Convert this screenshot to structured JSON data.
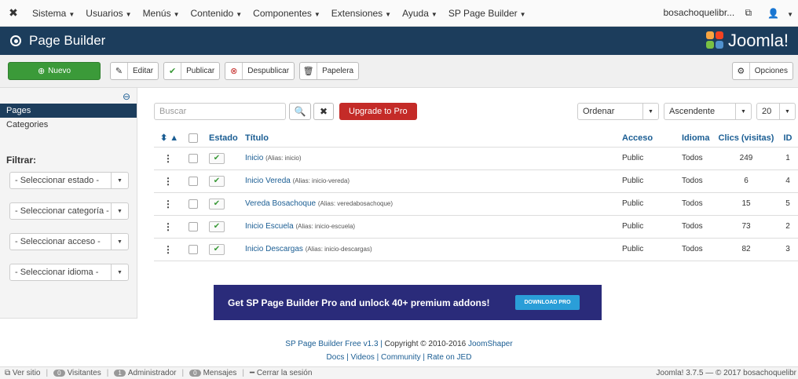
{
  "topbar": {
    "menu": [
      "Sistema",
      "Usuarios",
      "Menús",
      "Contenido",
      "Componentes",
      "Extensiones",
      "Ayuda",
      "SP Page Builder"
    ],
    "user": "bosachoquelibr...",
    "user_icon": "1"
  },
  "header": {
    "title": "Page Builder",
    "logo_text": "Joomla!"
  },
  "toolbar": {
    "new_label": "Nuevo",
    "edit_label": "Editar",
    "publish_label": "Publicar",
    "unpublish_label": "Despublicar",
    "trash_label": "Papelera",
    "options_label": "Opciones"
  },
  "sidebar": {
    "items": [
      "Pages",
      "Categories"
    ],
    "filter_title": "Filtrar:",
    "filters": [
      "- Seleccionar estado -",
      "- Seleccionar categoría -",
      "- Seleccionar acceso -",
      "- Seleccionar idioma -"
    ]
  },
  "list": {
    "search_placeholder": "Buscar",
    "upgrade_label": "Upgrade to Pro",
    "order_label": "Ordenar",
    "direction_label": "Ascendente",
    "limit_label": "20",
    "headers": {
      "estado": "Estado",
      "titulo": "Título",
      "acceso": "Acceso",
      "idioma": "Idioma",
      "clics": "Clics (visitas)",
      "id": "ID"
    },
    "rows": [
      {
        "title": "Inicio",
        "alias": "(Alias: inicio)",
        "access": "Public",
        "language": "Todos",
        "hits": "249",
        "id": "1"
      },
      {
        "title": "Inicio Vereda",
        "alias": "(Alias: inicio-vereda)",
        "access": "Public",
        "language": "Todos",
        "hits": "6",
        "id": "4"
      },
      {
        "title": "Vereda Bosachoque",
        "alias": "(Alias: veredabosachoque)",
        "access": "Public",
        "language": "Todos",
        "hits": "15",
        "id": "5"
      },
      {
        "title": "Inicio Escuela",
        "alias": "(Alias: inicio-escuela)",
        "access": "Public",
        "language": "Todos",
        "hits": "73",
        "id": "2"
      },
      {
        "title": "Inicio Descargas",
        "alias": "(Alias: inicio-descargas)",
        "access": "Public",
        "language": "Todos",
        "hits": "82",
        "id": "3"
      }
    ]
  },
  "banner": {
    "text": "Get SP Page Builder Pro and unlock 40+ premium addons!",
    "button": "DOWNLOAD PRO"
  },
  "credits": {
    "line1_a": "SP Page Builder Free v1.3 | ",
    "line1_b": "Copyright © 2010-2016 ",
    "line1_c": "JoomShaper",
    "line2": "Docs | Videos | Community | Rate on JED"
  },
  "statusbar": {
    "view_site": "Ver sitio",
    "visitors_count": "0",
    "visitors": "Visitantes",
    "admin_count": "1",
    "admin": "Administrador",
    "messages_count": "0",
    "messages": "Mensajes",
    "logout": "Cerrar la sesión",
    "version": "Joomla! 3.7.5 — © 2017 bosachoquelibr"
  },
  "colors": {
    "header_bg": "#1c3d5c",
    "new_button": "#3b9a39",
    "upgrade_button": "#c42b28",
    "banner_bg": "#2a2b7a",
    "link": "#1a5d93"
  }
}
